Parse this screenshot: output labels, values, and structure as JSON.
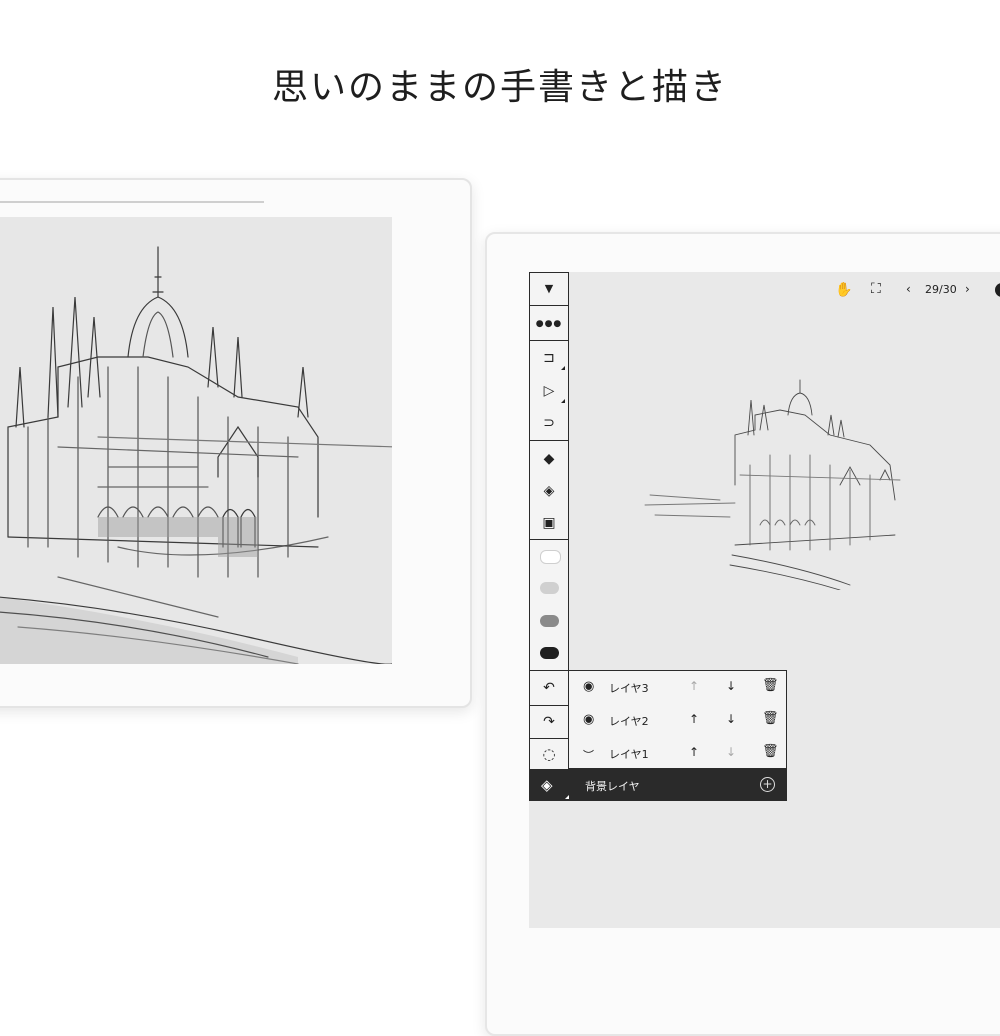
{
  "headline": "思いのままの手書きと描き",
  "canvas": {
    "page_indicator": "29/30",
    "prev_icon": "chevron-left-icon",
    "next_icon": "chevron-right-icon",
    "hand_icon": "hand-icon",
    "fullscreen_icon": "fullscreen-icon"
  },
  "toolbar": {
    "tools": [
      {
        "name": "collapse-toolbar",
        "icon": "triangle-down-icon",
        "glyph": "▼"
      },
      {
        "name": "more-options",
        "icon": "more-icon",
        "glyph": "•••"
      },
      {
        "name": "pen-tool",
        "icon": "pen-icon",
        "glyph": "✐"
      },
      {
        "name": "highlighter-tool",
        "icon": "marker-icon",
        "glyph": "▷"
      },
      {
        "name": "brush-tool",
        "icon": "brush-icon",
        "glyph": "⊃"
      },
      {
        "name": "eraser-tool",
        "icon": "eraser-icon",
        "glyph": "◇"
      },
      {
        "name": "stroke-eraser-tool",
        "icon": "eraser-dotted-icon",
        "glyph": "◈"
      },
      {
        "name": "clear-layer-tool",
        "icon": "clear-icon",
        "glyph": "▣"
      }
    ],
    "colors": [
      "#ffffff",
      "#d0d0d0",
      "#8a8a8a",
      "#1f1f1f"
    ],
    "undo_icon": "undo-icon",
    "redo_icon": "redo-icon",
    "lasso_icon": "lasso-icon"
  },
  "layers": [
    {
      "label": "レイヤ3",
      "visible": true,
      "up_enabled": false,
      "down_enabled": true
    },
    {
      "label": "レイヤ2",
      "visible": true,
      "up_enabled": true,
      "down_enabled": true
    },
    {
      "label": "レイヤ1",
      "visible": false,
      "up_enabled": true,
      "down_enabled": false
    }
  ],
  "background_layer": {
    "label": "背景レイヤ"
  }
}
